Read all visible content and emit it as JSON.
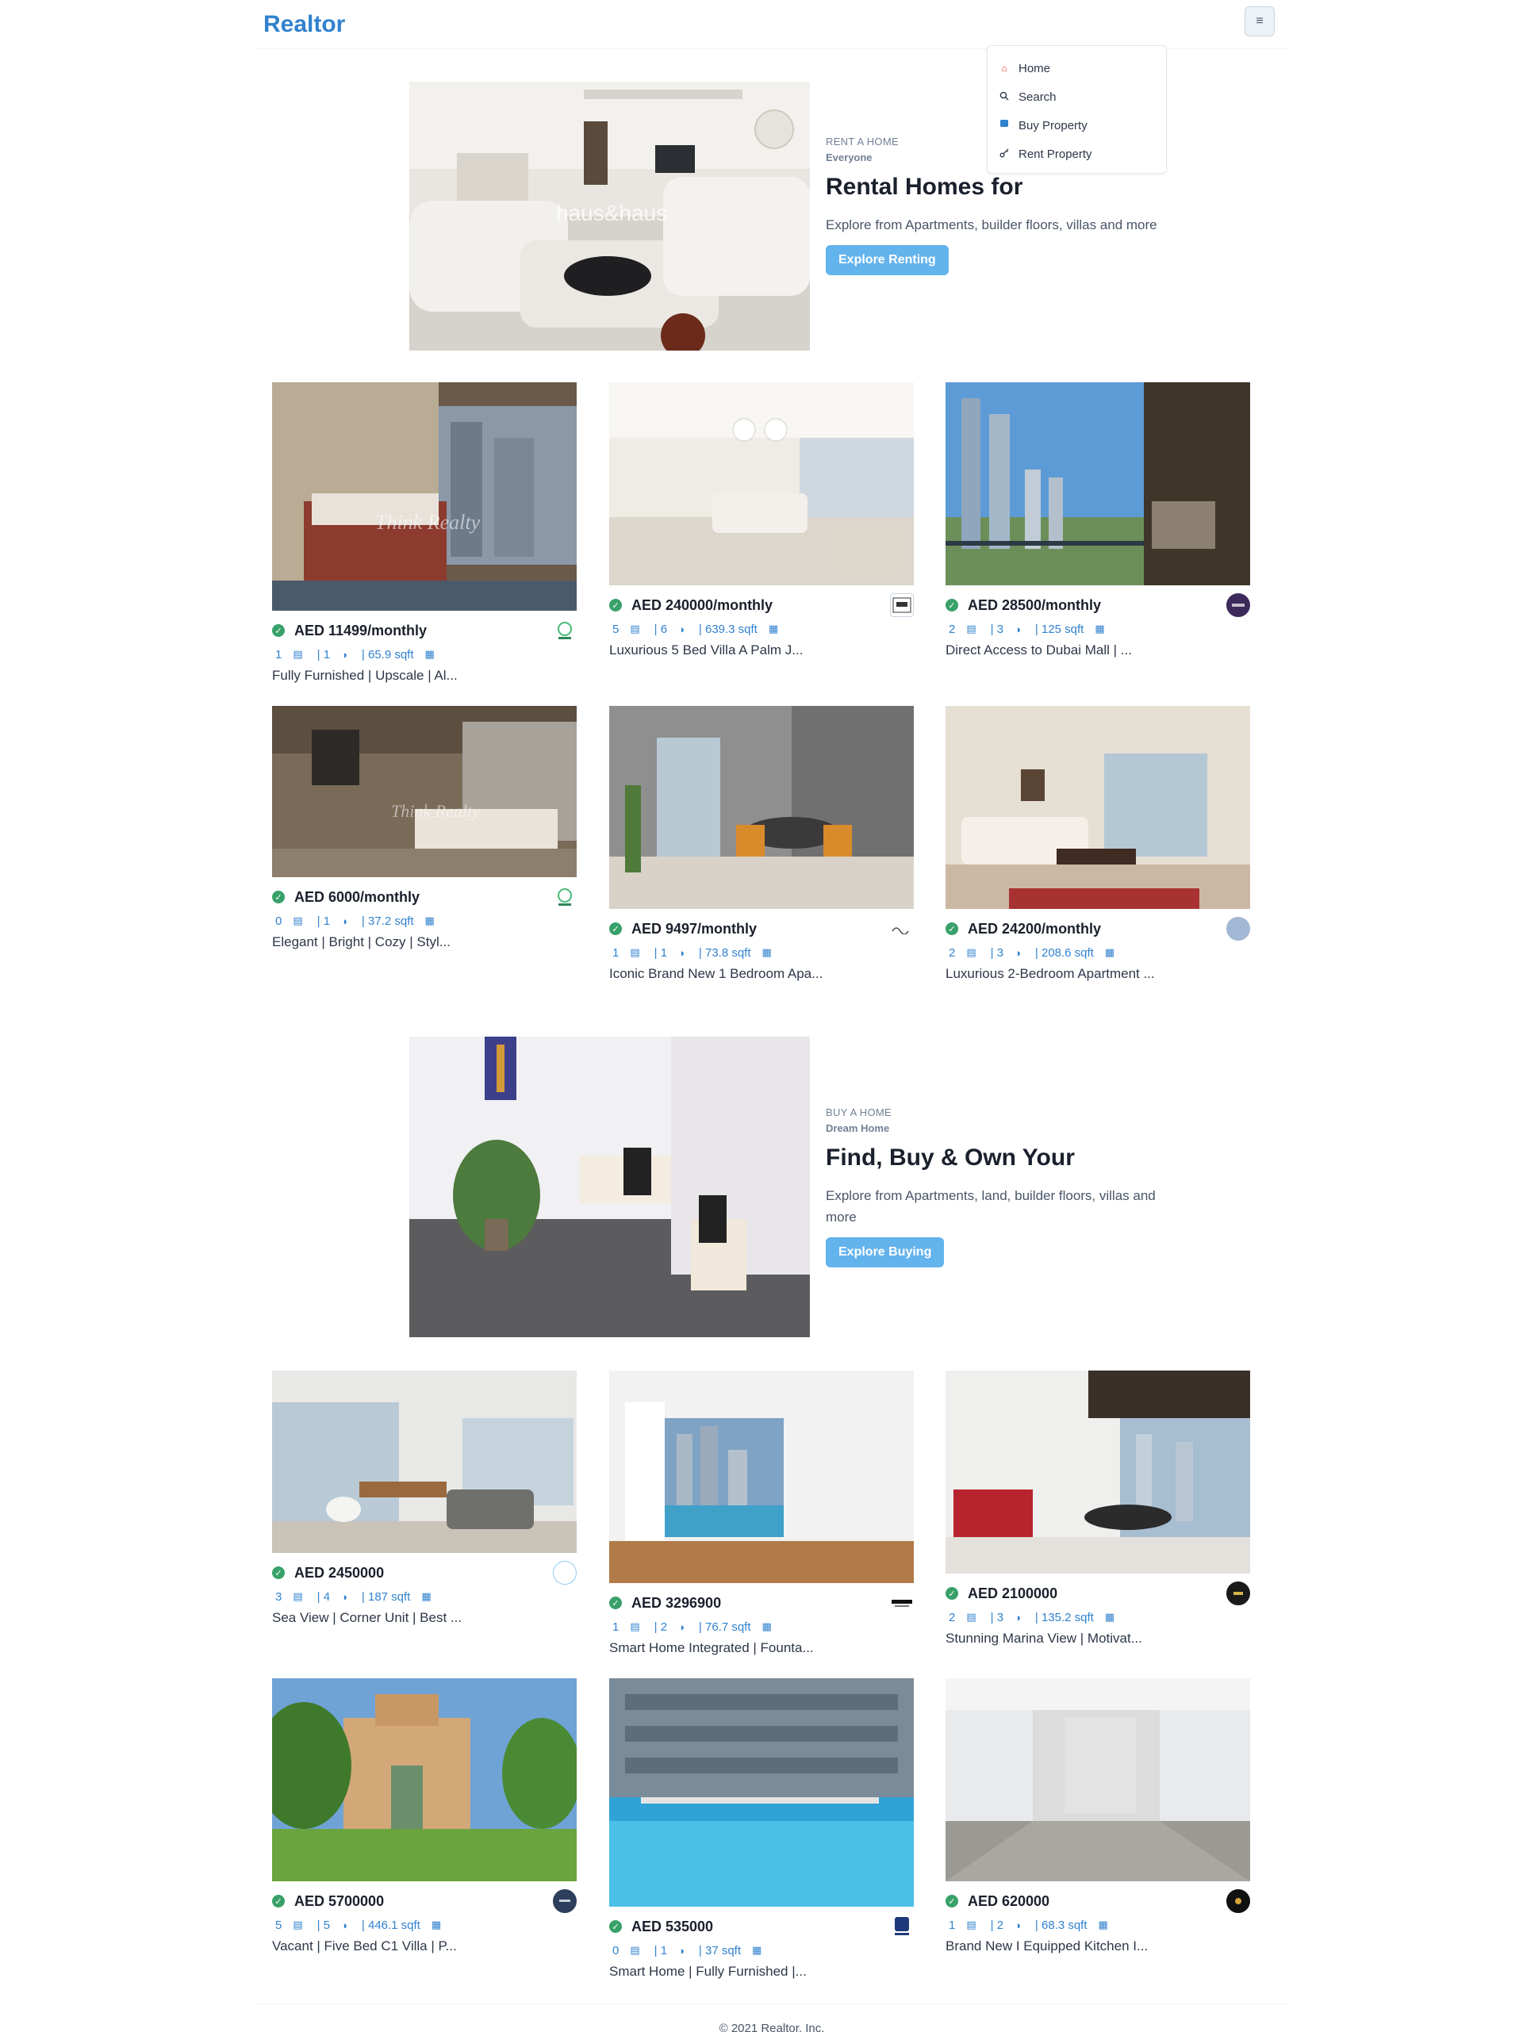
{
  "app": {
    "brand": "Realtor"
  },
  "nav": {
    "menu_icon": "hamburger-icon",
    "items": [
      {
        "label": "Home",
        "icon": "home-icon",
        "color": "#e53e3e"
      },
      {
        "label": "Search",
        "icon": "search-icon",
        "color": "#2d3748"
      },
      {
        "label": "Buy Property",
        "icon": "flag-icon",
        "color": "#3182ce"
      },
      {
        "label": "Rent Property",
        "icon": "key-icon",
        "color": "#2d3748"
      }
    ]
  },
  "rent_banner": {
    "kicker": "RENT A HOME",
    "kicker2": "Everyone",
    "title": "Rental Homes for",
    "description": "Explore from Apartments, builder floors, villas and more",
    "button": "Explore Renting"
  },
  "buy_banner": {
    "kicker": "BUY A HOME",
    "kicker2": "Dream Home",
    "title": "Find, Buy & Own Your",
    "description": "Explore from Apartments, land, builder floors, villas and more",
    "button": "Explore Buying"
  },
  "rent_listings": [
    {
      "price": "AED 11499/monthly",
      "rooms": "1",
      "baths": "| 1",
      "area": "| 65.9 sqft",
      "title": "Fully Furnished | Upscale | Al..."
    },
    {
      "price": "AED 240000/monthly",
      "rooms": "5",
      "baths": "| 6",
      "area": "| 639.3 sqft",
      "title": "Luxurious 5 Bed Villa A Palm J..."
    },
    {
      "price": "AED 28500/monthly",
      "rooms": "2",
      "baths": "| 3",
      "area": "| 125 sqft",
      "title": "Direct Access to Dubai Mall | ..."
    },
    {
      "price": "AED 6000/monthly",
      "rooms": "0",
      "baths": "| 1",
      "area": "| 37.2 sqft",
      "title": "Elegant | Bright | Cozy | Styl..."
    },
    {
      "price": "AED 9497/monthly",
      "rooms": "1",
      "baths": "| 1",
      "area": "| 73.8 sqft",
      "title": "Iconic Brand New 1 Bedroom Apa..."
    },
    {
      "price": "AED 24200/monthly",
      "rooms": "2",
      "baths": "| 3",
      "area": "| 208.6 sqft",
      "title": "Luxurious 2-Bedroom Apartment ..."
    }
  ],
  "buy_listings": [
    {
      "price": "AED 2450000",
      "rooms": "3",
      "baths": "| 4",
      "area": "| 187 sqft",
      "title": "Sea View | Corner Unit | Best ..."
    },
    {
      "price": "AED 3296900",
      "rooms": "1",
      "baths": "| 2",
      "area": "| 76.7 sqft",
      "title": "Smart Home Integrated | Founta..."
    },
    {
      "price": "AED 2100000",
      "rooms": "2",
      "baths": "| 3",
      "area": "| 135.2 sqft",
      "title": "Stunning Marina View | Motivat..."
    },
    {
      "price": "AED 5700000",
      "rooms": "5",
      "baths": "| 5",
      "area": "| 446.1 sqft",
      "title": "Vacant | Five Bed C1 Villa | P..."
    },
    {
      "price": "AED 535000",
      "rooms": "0",
      "baths": "| 1",
      "area": "| 37 sqft",
      "title": "Smart Home | Fully Furnished |..."
    },
    {
      "price": "AED 620000",
      "rooms": "1",
      "baths": "| 2",
      "area": "| 68.3 sqft",
      "title": "Brand New I Equipped Kitchen I..."
    }
  ],
  "footer": {
    "text": "© 2021 Realtor, Inc."
  }
}
